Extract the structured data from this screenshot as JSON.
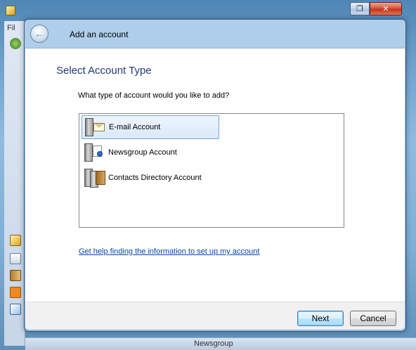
{
  "background_app": {
    "title_fragment": "",
    "menu_fragment": "Fil",
    "status_fragment": "Newsgroup"
  },
  "window_controls": {
    "restore_icon": "restore-icon",
    "close_icon": "close-icon",
    "close_glyph": "✕",
    "restore_glyph": "❐"
  },
  "dialog": {
    "title": "Add an account",
    "back_glyph": "←",
    "page_title": "Select Account Type",
    "question": "What type of account would you like to add?",
    "accounts": [
      {
        "label": "E-mail Account",
        "icon": "email-account-icon",
        "selected": true
      },
      {
        "label": "Newsgroup Account",
        "icon": "newsgroup-account-icon",
        "selected": false
      },
      {
        "label": "Contacts Directory Account",
        "icon": "contacts-directory-icon",
        "selected": false
      }
    ],
    "help_link": "Get help finding the information to set up my account",
    "buttons": {
      "next": "Next",
      "cancel": "Cancel"
    }
  },
  "colors": {
    "accent_title": "#1f3a7a",
    "link": "#0645ad",
    "selection_border": "#7da2ce"
  }
}
